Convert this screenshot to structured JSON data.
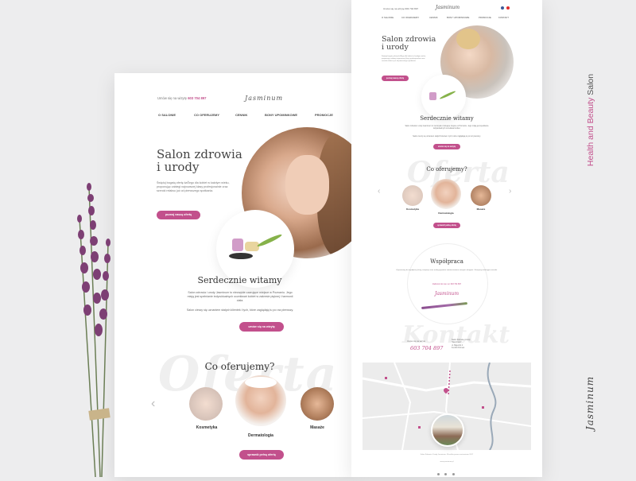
{
  "brand": {
    "logo": "Jasminum",
    "accent": "#c2508c",
    "background": "#ededee"
  },
  "side_label": {
    "accent_part": "Health and Beauty",
    "plain_part": "Salon"
  },
  "desktop": {
    "header": {
      "phone_prefix": "Umów się na wizytę",
      "phone": "603 704 897",
      "logo": "Jasminum"
    },
    "nav": [
      "O SALONIE",
      "CO OFERUJEMY",
      "CENNIK",
      "BONY UPOMINKOWE",
      "PROMOCJE"
    ],
    "hero": {
      "title_line1": "Salon zdrowia",
      "title_line2": "i urody",
      "text": "Świętuj bogatą ofertę kaŜego dla kobiet w każdym wieku, proponując zabiegi najnowszej klasy profesjonalnie oraz szeroki relaksu już od pierwszego spotkania.",
      "button": "poznaj naszą ofertę"
    },
    "welcome": {
      "title": "Serdecznie witamy",
      "text1": "Salon zdrowia i urody Jasminum to niezwykłe czarujące miejsce w Poznaniu. Jego misją jest spełnianie indywidualnych oczekiwań kobiet w zakresie pięknej i harmonii ciała.",
      "text2": "Salon cieszy się uznaniem stałych klientek i tych, które zaglądają tu po raz pierwszy.",
      "button": "umów się na wizytę"
    },
    "offer": {
      "bg_word": "Oferta",
      "title": "Co oferujemy?",
      "items": [
        "Kosmetyka",
        "Dermatologia",
        "Masaże"
      ],
      "button": "sprawdź pełną ofertę"
    }
  },
  "mobile": {
    "header": {
      "phone_text": "Umów się na wizytę 603 704 897",
      "logo": "Jasminum"
    },
    "nav": [
      "O SALONIE",
      "CO OFERUJEMY",
      "CENNIK",
      "BONY UPOMINKOWE",
      "PROMOCJE",
      "KONTAKT"
    ],
    "hero": {
      "title_line1": "Salon zdrowia",
      "title_line2": "i urody",
      "text": "Świętuj bogatą ofertę kaŜego dla kobiet w każdym wieku, proponując zabiegi najnowszej klasy profesjonalnie oraz szeroki relaksu już od pierwszego spotkania.",
      "button": "poznaj naszą ofertę"
    },
    "welcome": {
      "title": "Serdecznie witamy",
      "text1": "Salon zdrowia i urody Jasminum to niezwykłe czarujące miejsce w Poznaniu. Jego misją jest spełnianie indywidualnych oczekiwań kobiet.",
      "text2": "Salon cieszy się uznaniem stałych klientek i tych, które zaglądają tu po raz pierwszy.",
      "button": "umów się na wizytę"
    },
    "offer": {
      "bg_word": "Oferta",
      "title": "Co oferujemy?",
      "items": [
        "Kosmetyka",
        "Dermatologia",
        "Masaże"
      ],
      "button": "sprawdź pełną ofertę"
    },
    "cooperation": {
      "title": "Współpraca",
      "text": "Zapraszamy do współpracy firmy, instytucje oraz osoby prywatne zainteresowane naszymi usługami. Oferujemy atrakcyjne warunki.",
      "phone_line": "Zadzwoń do nas: tel. 603 704 897",
      "signature": "Jasminum"
    },
    "contact": {
      "bg_word": "Kontakt",
      "label": "Umów się na wizytę",
      "phone": "603 704 897",
      "address": [
        "Salon Zdrowia i Urody",
        "\"Jasminum\"",
        "ul. Bajeczki 4",
        "61-000 Poznań"
      ]
    },
    "footer": {
      "text": "Salon Zdrowia i Urody Jasminum. Wszelkie prawa zastrzeżone 2017",
      "url": "www.jasminum.pl"
    }
  }
}
